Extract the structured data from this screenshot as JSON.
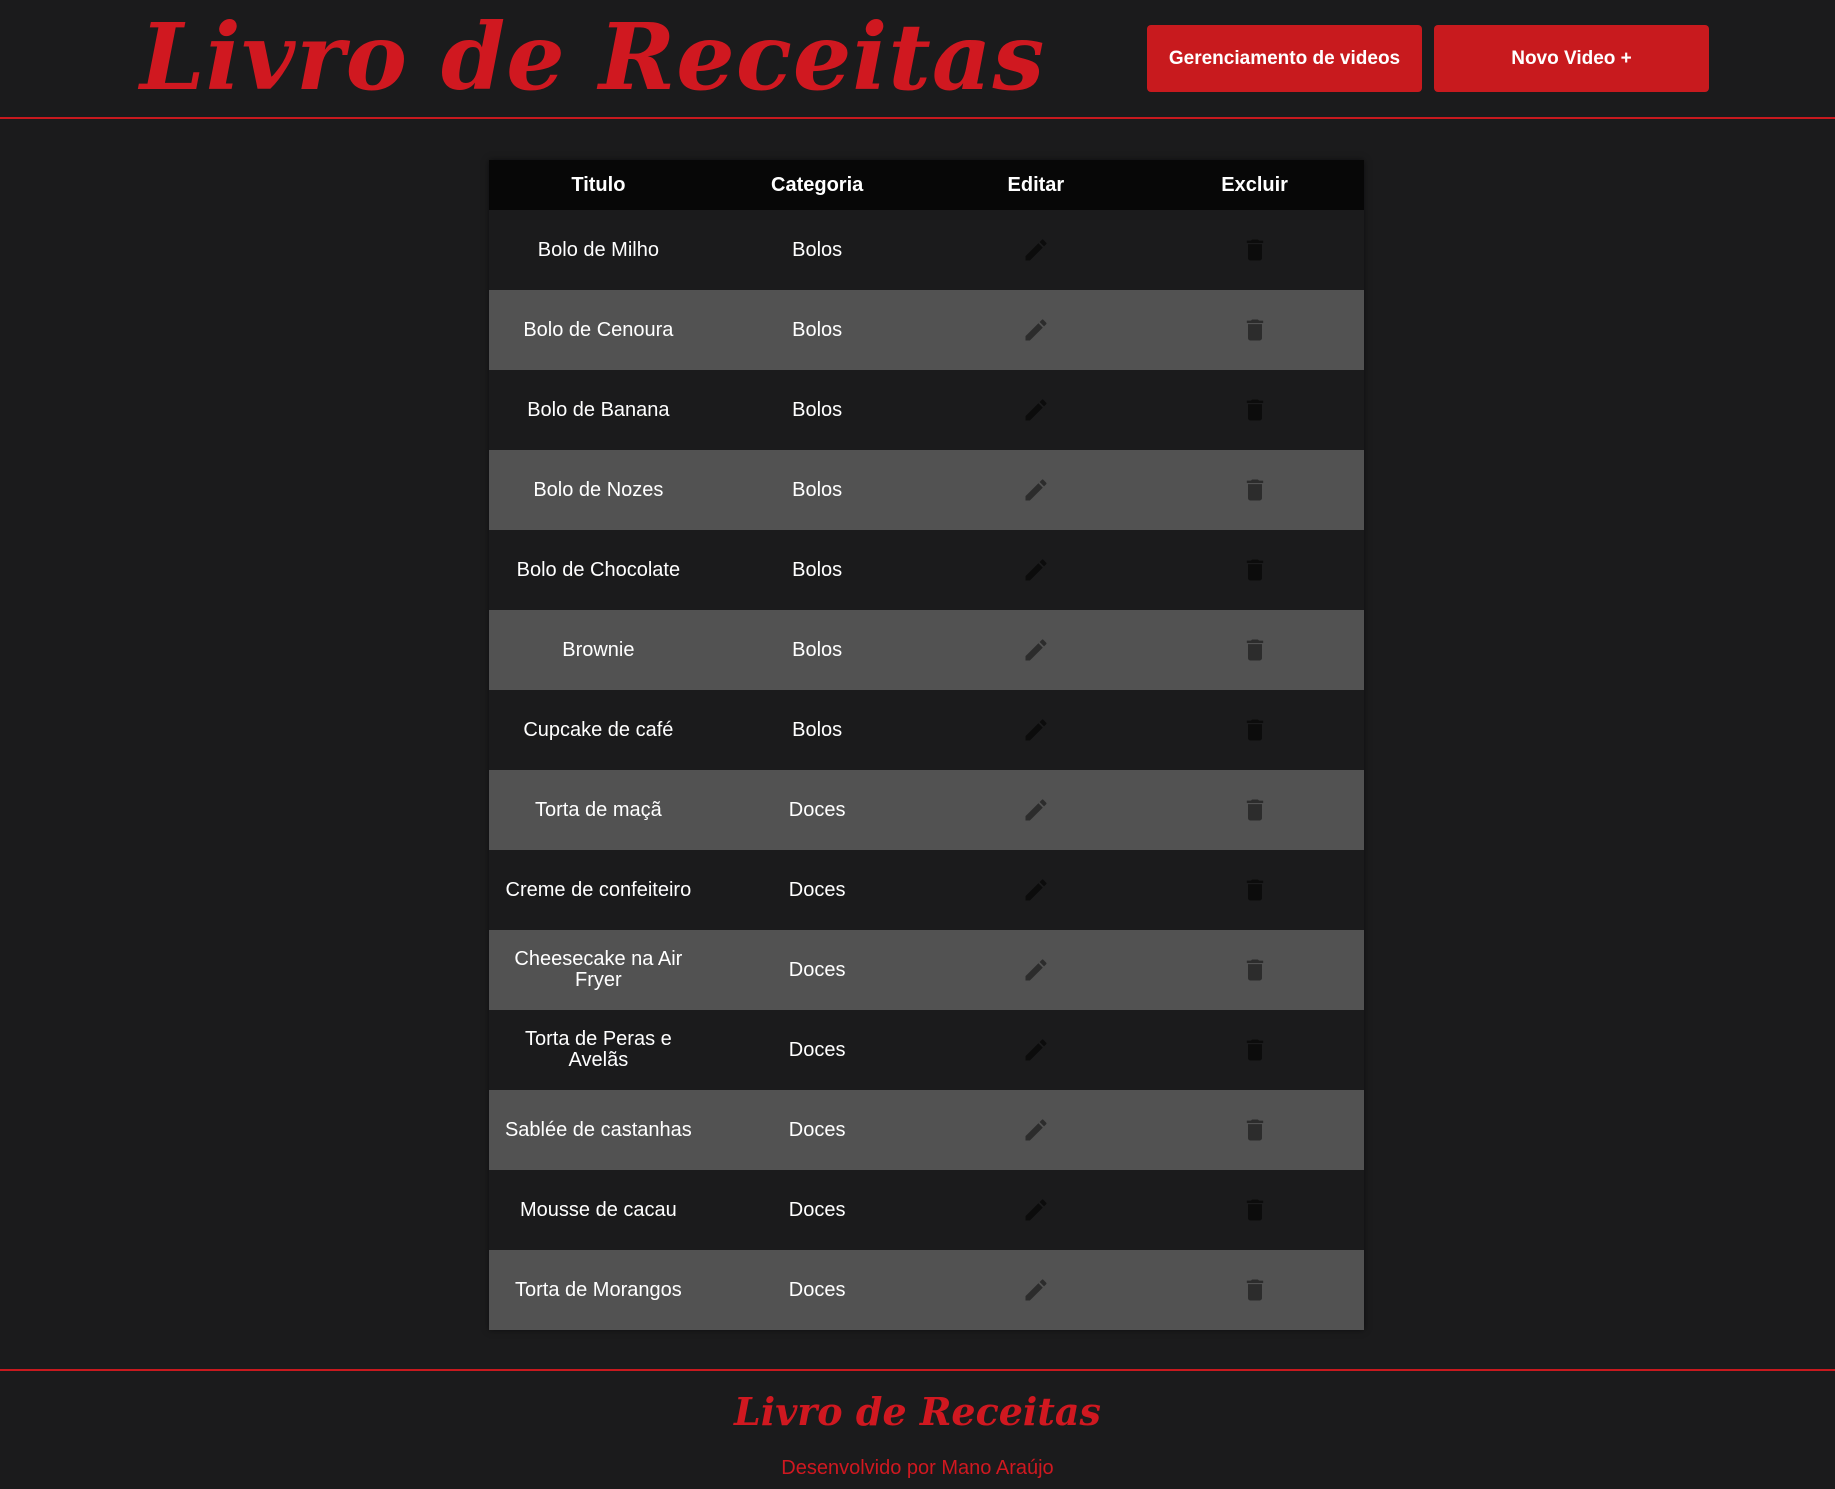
{
  "header": {
    "logo": "Livro de Receitas",
    "manage_button": "Gerenciamento de videos",
    "new_button": "Novo Video +"
  },
  "table": {
    "columns": [
      "Titulo",
      "Categoria",
      "Editar",
      "Excluir"
    ],
    "rows": [
      {
        "titulo": "Bolo de Milho",
        "categoria": "Bolos"
      },
      {
        "titulo": "Bolo de Cenoura",
        "categoria": "Bolos"
      },
      {
        "titulo": "Bolo de Banana",
        "categoria": "Bolos"
      },
      {
        "titulo": "Bolo de Nozes",
        "categoria": "Bolos"
      },
      {
        "titulo": "Bolo de Chocolate",
        "categoria": "Bolos"
      },
      {
        "titulo": "Brownie",
        "categoria": "Bolos"
      },
      {
        "titulo": "Cupcake de café",
        "categoria": "Bolos"
      },
      {
        "titulo": "Torta de maçã",
        "categoria": "Doces"
      },
      {
        "titulo": "Creme de confeiteiro",
        "categoria": "Doces"
      },
      {
        "titulo": "Cheesecake na Air Fryer",
        "categoria": "Doces"
      },
      {
        "titulo": "Torta de Peras e Avelãs",
        "categoria": "Doces"
      },
      {
        "titulo": "Sablée de castanhas",
        "categoria": "Doces"
      },
      {
        "titulo": "Mousse de cacau",
        "categoria": "Doces"
      },
      {
        "titulo": "Torta de Morangos",
        "categoria": "Doces"
      }
    ],
    "edit_icon": "pencil-icon",
    "delete_icon": "trash-icon"
  },
  "footer": {
    "logo": "Livro de Receitas",
    "credit": "Desenvolvido por Mano Araújo"
  },
  "colors": {
    "accent": "#c81a1e",
    "background": "#1b1b1c",
    "row_alt": "#525252",
    "table_header": "#070707"
  }
}
